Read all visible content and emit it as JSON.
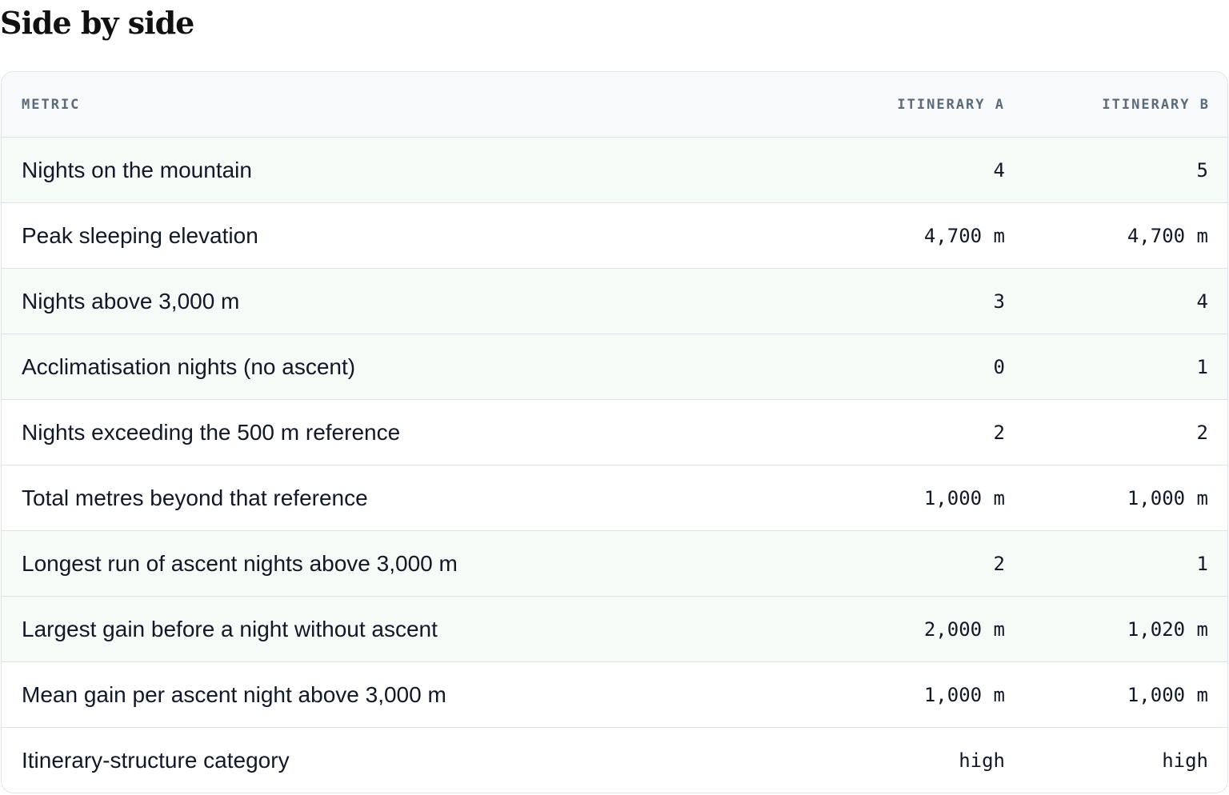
{
  "page": {
    "title": "Side by side"
  },
  "table": {
    "headers": {
      "metric": "METRIC",
      "a": "ITINERARY A",
      "b": "ITINERARY B"
    },
    "rows": [
      {
        "metric": "Nights on the mountain",
        "a": "4",
        "b": "5"
      },
      {
        "metric": "Peak sleeping elevation",
        "a": "4,700 m",
        "b": "4,700 m"
      },
      {
        "metric": "Nights above 3,000 m",
        "a": "3",
        "b": "4"
      },
      {
        "metric": "Acclimatisation nights (no ascent)",
        "a": "0",
        "b": "1"
      },
      {
        "metric": "Nights exceeding the 500 m reference",
        "a": "2",
        "b": "2"
      },
      {
        "metric": "Total metres beyond that reference",
        "a": "1,000 m",
        "b": "1,000 m"
      },
      {
        "metric": "Longest run of ascent nights above 3,000 m",
        "a": "2",
        "b": "1"
      },
      {
        "metric": "Largest gain before a night without ascent",
        "a": "2,000 m",
        "b": "1,020 m"
      },
      {
        "metric": "Mean gain per ascent night above 3,000 m",
        "a": "1,000 m",
        "b": "1,000 m"
      },
      {
        "metric": "Itinerary-structure category",
        "a": "high",
        "b": "high"
      }
    ]
  },
  "colors": {
    "tinted_row": "#f5fbf7",
    "header_bg": "#f7f9fb",
    "header_text": "#5b6b7a",
    "border": "#dde3e8"
  }
}
